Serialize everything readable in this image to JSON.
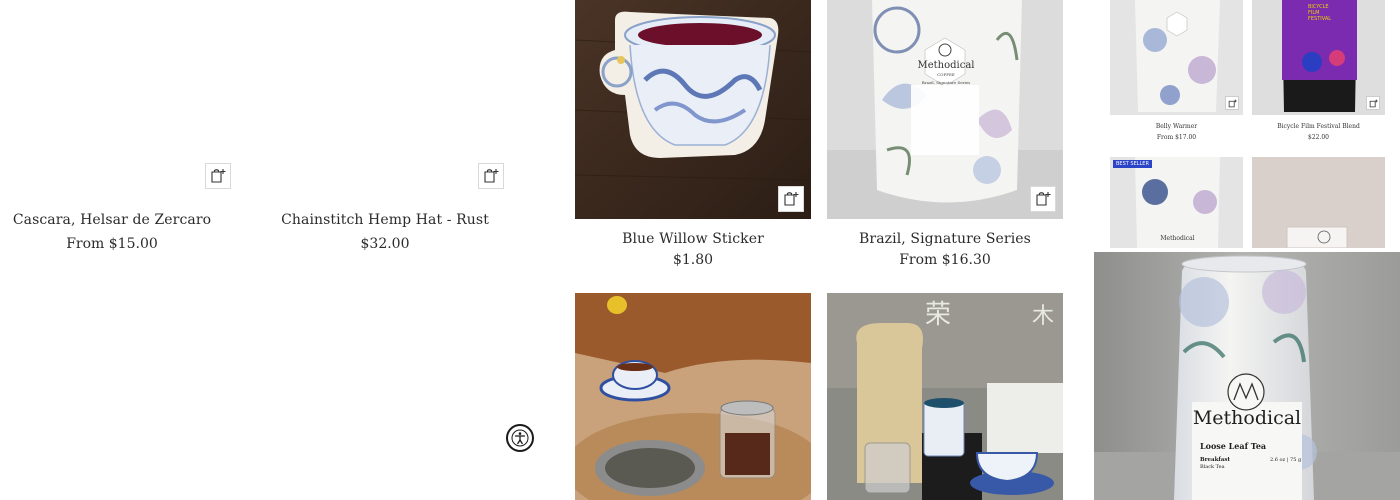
{
  "products_left": [
    {
      "title": "Cascara, Helsar de Zercaro",
      "price": "From $15.00"
    },
    {
      "title": "Chainstitch Hemp Hat - Rust",
      "price": "$32.00"
    }
  ],
  "products_mid": [
    {
      "title": "Blue Willow Sticker",
      "price": "$1.80"
    },
    {
      "title": "Brazil, Signature Series",
      "price": "From $16.30"
    }
  ],
  "mini_products": [
    {
      "title": "Belly Warmer",
      "price": "From $17.00"
    },
    {
      "title": "Bicycle Film Festival Blend",
      "price": "$22.00"
    }
  ],
  "mini_badge": "BEST SELLER",
  "brand": "Methodical",
  "tea_tin": {
    "brand": "Methodical",
    "line": "Loose Leaf Tea",
    "variety": "Breakfast",
    "subvariety": "Black Tea",
    "weight": "2.6 oz | 75 g"
  },
  "coffee_bag": {
    "brand": "Methodical",
    "kind": "COFFEE",
    "series": "Brazil, Signature Series"
  },
  "poster": {
    "line1": "BICYCLE",
    "line2": "FILM",
    "line3": "FESTIVAL"
  },
  "icons": {
    "cart": "add-to-cart-icon",
    "accessibility": "accessibility-icon"
  }
}
